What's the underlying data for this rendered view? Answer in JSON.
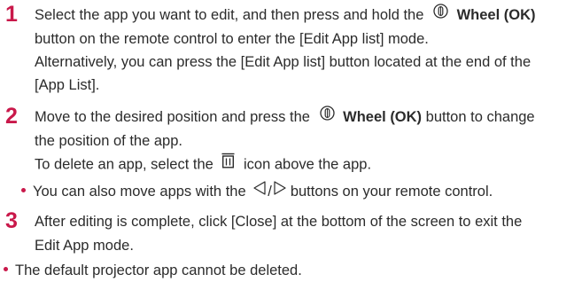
{
  "steps": [
    {
      "number": "1",
      "l1_pre": "Select the app you want to edit, and then press and hold the",
      "l1_bold": "Wheel (OK)",
      "l2": "button on the remote control to enter the [Edit App list] mode.",
      "l3": "Alternatively, you can press the [Edit App list] button located at the end of the",
      "l4": "[App List]."
    },
    {
      "number": "2",
      "l1_pre": "Move to the desired position and press the",
      "l1_bold": "Wheel (OK)",
      "l1_post": "button to change",
      "l2": "the position of the app.",
      "l3_pre": "To delete an app, select the",
      "l3_post": "icon above the app.",
      "sub_pre": "You can also move apps with the",
      "sub_post": "buttons on your remote control."
    },
    {
      "number": "3",
      "l1": "After editing is complete, click [Close] at the bottom of the screen to exit the",
      "l2": "Edit App mode."
    }
  ],
  "note": "The default projector app cannot be deleted.",
  "colors": {
    "accent": "#c9184a",
    "text": "#2b2b2b"
  },
  "icons": [
    "wheel-ok-icon",
    "trash-icon",
    "left-arrow-icon",
    "right-arrow-icon"
  ]
}
